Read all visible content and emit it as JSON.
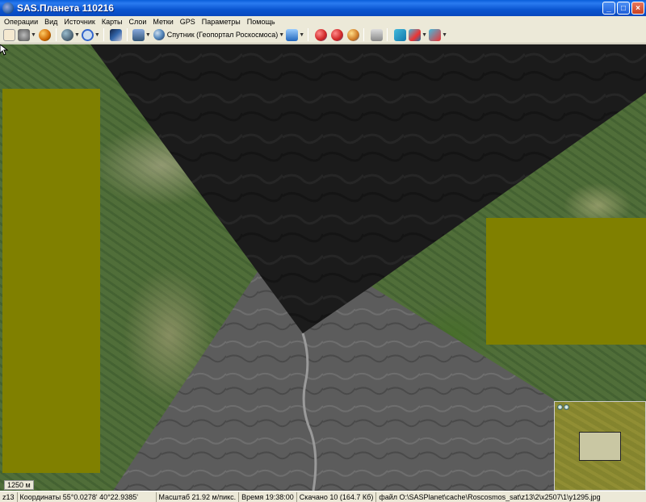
{
  "window": {
    "title": "SAS.Планета 110216"
  },
  "menu": [
    "Операции",
    "Вид",
    "Источник",
    "Карты",
    "Слои",
    "Метки",
    "GPS",
    "Параметры",
    "Помощь"
  ],
  "toolbar": {
    "map_source_label": "Спутник (Геопортал Роскосмоса)",
    "icons": [
      "hand-icon",
      "zoom-icon",
      "globe-icon",
      "layers-icon",
      "map-icon",
      "gps-icon",
      "mark-icon",
      "route-icon",
      "delete-icon",
      "settings-icon"
    ]
  },
  "map": {
    "scale_label": "1250 м",
    "colors": {
      "overlay": "#808000",
      "dark_tile": "#1b1b1b",
      "gray_tile": "#5c5c5c"
    }
  },
  "status": {
    "zoom": "z13",
    "coordinates": "Координаты 55°0.0278' 40°22.9385'",
    "scale": "Масштаб 21.92 м/пикс.",
    "time": "Время 19:38:00",
    "downloaded": "Скачано 10 (164.7 Кб)",
    "file": "файл O:\\SASPlanet\\cache\\Roscosmos_sat\\z13\\2\\x2507\\1\\y1295.jpg"
  }
}
